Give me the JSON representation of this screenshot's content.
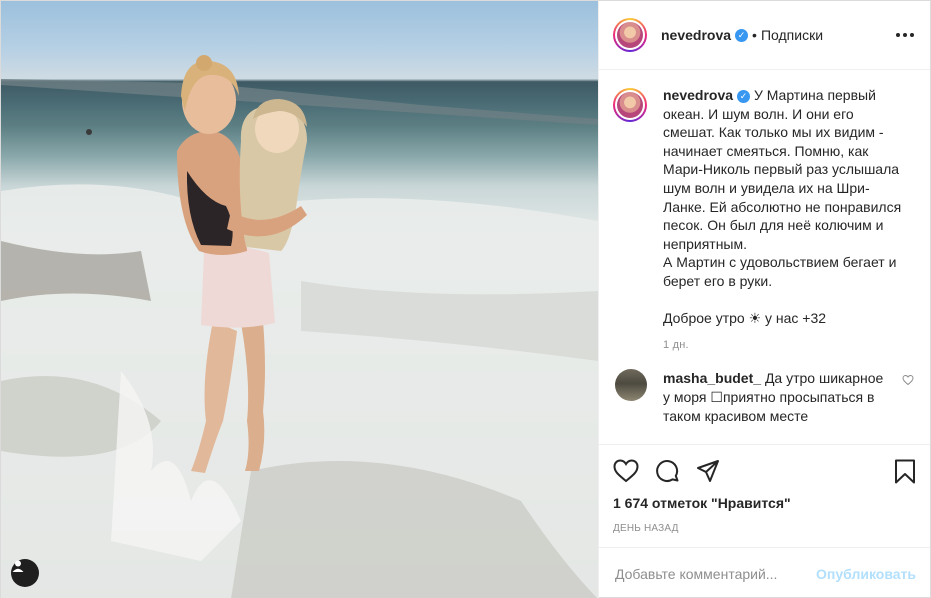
{
  "post": {
    "username": "nevedrova",
    "separator": "•",
    "follow_label": "Подписки",
    "caption_lines": [
      "У Мартина первый",
      "океан. И шум волн. И они его",
      "смешат. Как только мы их видим -",
      "начинает смеяться. Помню, как",
      "Мари-Николь первый раз услышала",
      "шум волн и увидела их на Шри-",
      "Ланке. Ей абсолютно не понравился",
      "песок. Он был для неё колючим и",
      "неприятным.",
      "А Мартин с удовольствием бегает и",
      "берет его в руки.",
      "",
      "Доброе утро ☀ у нас +32"
    ],
    "time_ago": "1 дн.",
    "comment": {
      "username": "masha_budet_",
      "text": "Да утро шикарное у моря ☐приятно просыпаться в таком красивом месте"
    },
    "likes": "1 674 отметок \"Нравится\"",
    "date": "ДЕНЬ НАЗАД",
    "add_comment_placeholder": "Добавьте комментарий...",
    "publish_label": "Опубликовать"
  },
  "icons": {
    "verified": "verified-badge-icon",
    "more": "more-options-icon",
    "like": "heart-icon",
    "comment": "comment-icon",
    "share": "share-icon",
    "save": "bookmark-icon",
    "user_tag": "user-tag-icon"
  },
  "colors": {
    "accent": "#3897f0",
    "publish_disabled": "#b2dffc",
    "muted": "#8e8e8e"
  }
}
